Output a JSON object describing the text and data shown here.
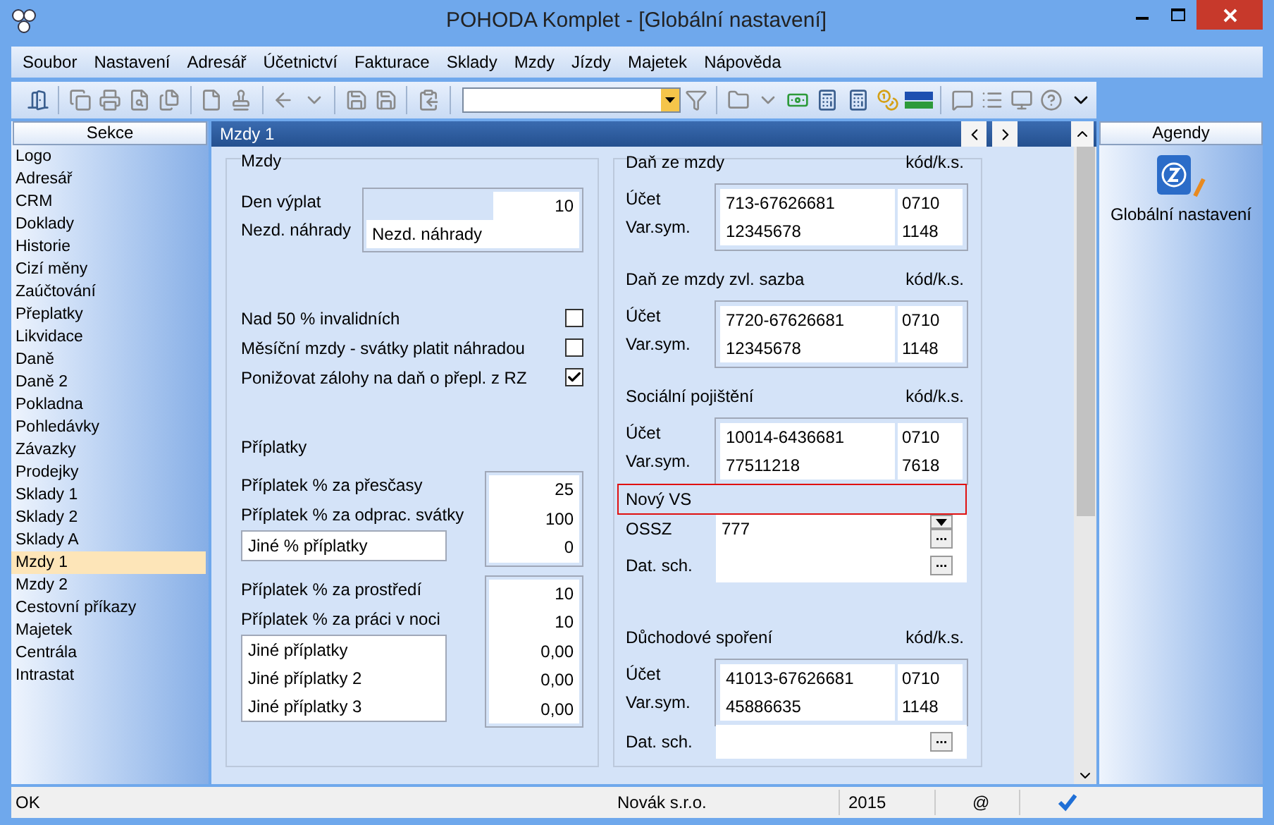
{
  "window": {
    "title": "POHODA Komplet - [Globální nastavení]"
  },
  "menu": [
    "Soubor",
    "Nastavení",
    "Adresář",
    "Účetnictví",
    "Fakturace",
    "Sklady",
    "Mzdy",
    "Jízdy",
    "Majetek",
    "Nápověda"
  ],
  "sidebar": {
    "header": "Sekce",
    "items": [
      {
        "label": "Logo",
        "selected": false
      },
      {
        "label": "Adresář",
        "selected": false
      },
      {
        "label": "CRM",
        "selected": false
      },
      {
        "label": "Doklady",
        "selected": false
      },
      {
        "label": "Historie",
        "selected": false
      },
      {
        "label": "Cizí měny",
        "selected": false
      },
      {
        "label": "Zaúčtování",
        "selected": false
      },
      {
        "label": "Přeplatky",
        "selected": false
      },
      {
        "label": "Likvidace",
        "selected": false
      },
      {
        "label": "Daně",
        "selected": false
      },
      {
        "label": "Daně 2",
        "selected": false
      },
      {
        "label": "Pokladna",
        "selected": false
      },
      {
        "label": "Pohledávky",
        "selected": false
      },
      {
        "label": "Závazky",
        "selected": false
      },
      {
        "label": "Prodejky",
        "selected": false
      },
      {
        "label": "Sklady 1",
        "selected": false
      },
      {
        "label": "Sklady 2",
        "selected": false
      },
      {
        "label": "Sklady A",
        "selected": false
      },
      {
        "label": "Mzdy 1",
        "selected": true
      },
      {
        "label": "Mzdy 2",
        "selected": false
      },
      {
        "label": "Cestovní příkazy",
        "selected": false
      },
      {
        "label": "Majetek",
        "selected": false
      },
      {
        "label": "Centrála",
        "selected": false
      },
      {
        "label": "Intrastat",
        "selected": false
      }
    ]
  },
  "panel": {
    "title": "Mzdy 1",
    "mzdy": {
      "title": "Mzdy",
      "fields": [
        {
          "label": "Den výplat",
          "value": "10"
        },
        {
          "label": "Nezd. náhrady",
          "value": "Nezd. náhrady"
        }
      ]
    },
    "options": [
      {
        "label": "Nad 50 % invalidních",
        "checked": false
      },
      {
        "label": "Měsíční mzdy - svátky platit náhradou",
        "checked": false
      },
      {
        "label": "Ponižovat zálohy na daň o přepl. z RZ",
        "checked": true
      }
    ],
    "priplatky": {
      "title": "Příplatky",
      "groups": [
        {
          "rows": [
            {
              "label": "Příplatek % za přesčasy",
              "value": "25"
            },
            {
              "label": "Příplatek % za odprac. svátky",
              "value": "100"
            }
          ],
          "other": [
            {
              "label": "Jiné % příplatky",
              "value": "0"
            }
          ]
        },
        {
          "rows": [
            {
              "label": "Příplatek % za prostředí",
              "value": "10"
            },
            {
              "label": "Příplatek % za práci v noci",
              "value": "10"
            }
          ],
          "other": [
            {
              "label": "Jiné příplatky",
              "value": "0,00"
            },
            {
              "label": "Jiné příplatky 2",
              "value": "0,00"
            },
            {
              "label": "Jiné příplatky 3",
              "value": "0,00"
            }
          ]
        }
      ]
    },
    "accounts": [
      {
        "title": "Daň ze mzdy",
        "code_header": "kód/k.s.",
        "rows": [
          {
            "label": "Účet",
            "value": "713-67626681",
            "code": "0710"
          },
          {
            "label": "Var.sym.",
            "value": "12345678",
            "code": "1148"
          }
        ]
      },
      {
        "title": "Daň ze mzdy zvl. sazba",
        "code_header": "kód/k.s.",
        "rows": [
          {
            "label": "Účet",
            "value": "7720-67626681",
            "code": "0710"
          },
          {
            "label": "Var.sym.",
            "value": "12345678",
            "code": "1148"
          }
        ]
      },
      {
        "title": "Sociální pojištění",
        "code_header": "kód/k.s.",
        "rows": [
          {
            "label": "Účet",
            "value": "10014-6436681",
            "code": "0710"
          },
          {
            "label": "Var.sym.",
            "value": "77511218",
            "code": "7618"
          }
        ],
        "extra": [
          {
            "kind": "highlighted",
            "label": "Nový VS"
          },
          {
            "kind": "select",
            "label": "OSSZ",
            "value": "777",
            "button": "..."
          },
          {
            "kind": "browse",
            "label": "Dat. sch.",
            "button": "..."
          }
        ]
      },
      {
        "title": "Důchodové spoření",
        "code_header": "kód/k.s.",
        "rows": [
          {
            "label": "Účet",
            "value": "41013-67626681",
            "code": "0710"
          },
          {
            "label": "Var.sym.",
            "value": "45886635",
            "code": "1148"
          }
        ],
        "extra": [
          {
            "kind": "browse",
            "label": "Dat. sch.",
            "button": "..."
          }
        ]
      }
    ]
  },
  "agenda": {
    "header": "Agendy",
    "items": [
      {
        "label": "Globální nastavení"
      }
    ]
  },
  "status_bar": {
    "message": "OK",
    "company": "Novák s.r.o.",
    "year": "2015",
    "mail": "@"
  }
}
